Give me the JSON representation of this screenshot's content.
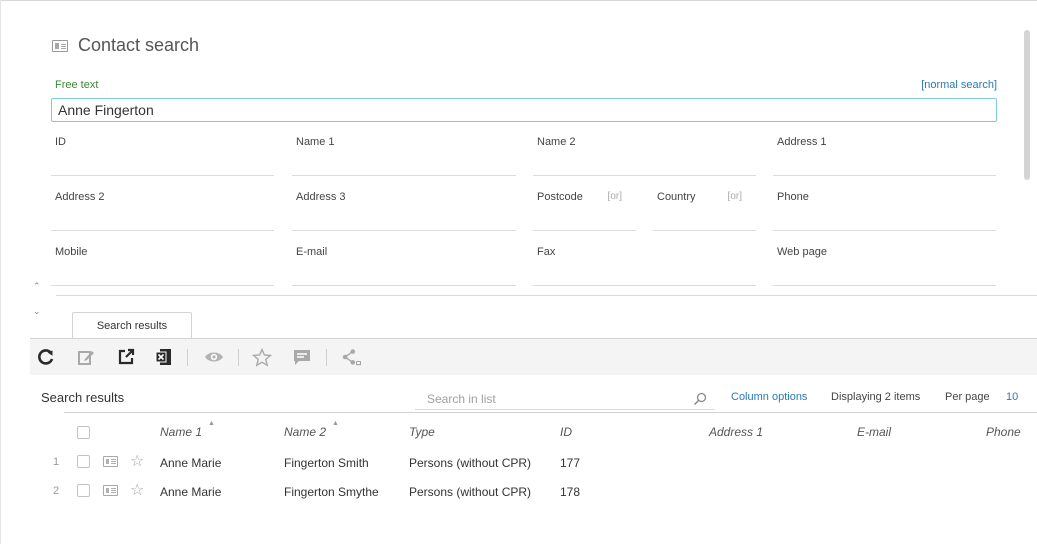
{
  "panel": {
    "title": "Contact search",
    "icon": "contact-card-icon",
    "free_text_label": "Free text",
    "normal_search_link": "[normal search]",
    "free_text_value": "Anne Fingerton"
  },
  "fields": {
    "id": "ID",
    "name1": "Name 1",
    "name2": "Name 2",
    "address1": "Address 1",
    "address2": "Address 2",
    "address3": "Address 3",
    "postcode": "Postcode",
    "postcode_or": "[or]",
    "country": "Country",
    "country_or": "[or]",
    "phone": "Phone",
    "mobile": "Mobile",
    "email": "E-mail",
    "fax": "Fax",
    "webpage": "Web page"
  },
  "tab": {
    "label": "Search results"
  },
  "toolbar": {
    "icons": [
      "refresh-icon",
      "edit-icon",
      "open-external-icon",
      "excel-export-icon",
      "view-icon",
      "favorite-icon",
      "message-icon",
      "share-icon"
    ]
  },
  "results": {
    "title": "Search results",
    "search_placeholder": "Search in list",
    "column_options": "Column options",
    "displaying": "Displaying 2 items",
    "per_page_label": "Per page",
    "per_page_value": "10",
    "columns": [
      "Name 1",
      "Name 2",
      "Type",
      "ID",
      "Address 1",
      "E-mail",
      "Phone"
    ],
    "rows": [
      {
        "num": "1",
        "name1": "Anne Marie",
        "name2": "Fingerton Smith",
        "type": "Persons (without CPR)",
        "id": "177"
      },
      {
        "num": "2",
        "name1": "Anne Marie",
        "name2": "Fingerton Smythe",
        "type": "Persons (without CPR)",
        "id": "178"
      }
    ]
  },
  "colors": {
    "accent_link": "#2a7ab8",
    "label_green": "#3a8a3a",
    "input_focus_border": "#7ec9e4",
    "toolbar_bg": "#f4f4f4"
  }
}
